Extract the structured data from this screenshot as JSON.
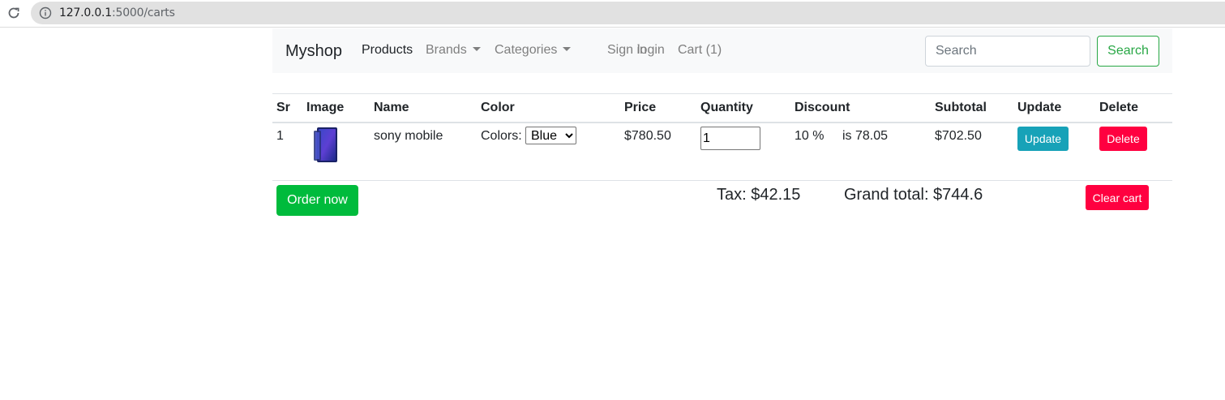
{
  "browser": {
    "url_host": "127.0.0.1",
    "url_rest": ":5000/carts",
    "reload_icon": "reload-icon",
    "info_icon": "info-icon"
  },
  "navbar": {
    "brand": "Myshop",
    "items": [
      {
        "label": "Products",
        "active": true
      },
      {
        "label": "Brands",
        "dropdown": true
      },
      {
        "label": "Categories",
        "dropdown": true
      },
      {
        "label": "Sign in"
      },
      {
        "label": "login"
      },
      {
        "label": "Cart (1)"
      }
    ],
    "search_placeholder": "Search",
    "search_button": "Search"
  },
  "cart": {
    "headers": [
      "Sr",
      "Image",
      "Name",
      "Color",
      "Price",
      "Quantity",
      "Discount",
      "Subtotal",
      "Update",
      "Delete"
    ],
    "rows": [
      {
        "sr": "1",
        "image_icon": "phone-icon",
        "name": "sony mobile",
        "color_label": "Colors:",
        "color_selected": "Blue",
        "price": "$780.50",
        "quantity": "1",
        "discount_percent": "10 %",
        "discount_amount": "is 78.05",
        "subtotal": "$702.50",
        "update_label": "Update",
        "delete_label": "Delete"
      }
    ],
    "order_button": "Order now",
    "tax": "Tax: $42.15",
    "grand_total": "Grand total: $744.6",
    "clear_button": "Clear cart"
  },
  "colors": {
    "navbar_bg": "#f8f9fa",
    "success": "#28a745",
    "info": "#17a2b8",
    "danger": "#ff0040"
  }
}
